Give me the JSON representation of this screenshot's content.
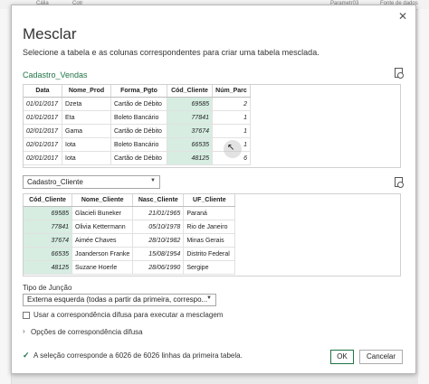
{
  "background": {
    "col_labels": [
      "Cália",
      "Cotr",
      "Parametr03",
      "Fonte de dados"
    ]
  },
  "dialog": {
    "title": "Mesclar",
    "subtitle": "Selecione a tabela e as colunas correspondentes para criar uma tabela mesclada.",
    "close_glyph": "✕"
  },
  "table1": {
    "name": "Cadastro_Vendas",
    "columns": [
      "Data",
      "Nome_Prod",
      "Forma_Pgto",
      "Cód_Cliente",
      "Núm_Parc"
    ],
    "rows": [
      [
        "01/01/2017",
        "Dzeta",
        "Cartão de Débito",
        "69585",
        "2"
      ],
      [
        "01/01/2017",
        "Eta",
        "Boleto Bancário",
        "77841",
        "1"
      ],
      [
        "02/01/2017",
        "Gama",
        "Cartão de Débito",
        "37674",
        "1"
      ],
      [
        "02/01/2017",
        "Iota",
        "Boleto Bancário",
        "66535",
        "1"
      ],
      [
        "02/01/2017",
        "Iota",
        "Cartão de Débito",
        "48125",
        "6"
      ]
    ],
    "selected_column_index": 3
  },
  "table2": {
    "dropdown_value": "Cadastro_Cliente",
    "columns": [
      "Cód_Cliente",
      "Nome_Cliente",
      "Nasc_Cliente",
      "UF_Cliente"
    ],
    "rows": [
      [
        "69585",
        "Glacieli Buneker",
        "21/01/1965",
        "Paraná"
      ],
      [
        "77841",
        "Olivia Kettermann",
        "05/10/1978",
        "Rio de Janeiro"
      ],
      [
        "37674",
        "Aimée Chaves",
        "28/10/1982",
        "Minas Gerais"
      ],
      [
        "66535",
        "Joanderson Franke",
        "15/08/1954",
        "Distrito Federal"
      ],
      [
        "48125",
        "Suzane Hoerle",
        "28/06/1990",
        "Sergipe"
      ]
    ],
    "selected_column_index": 0
  },
  "join": {
    "label": "Tipo de Junção",
    "value": "Externa esquerda (todas a partir da primeira, correspo...",
    "fuzzy_checkbox_label": "Usar a correspondência difusa para executar a mesclagem",
    "fuzzy_checked": false,
    "fuzzy_options_label": "Opções de correspondência difusa"
  },
  "status": {
    "text": "A seleção corresponde a 6026 de 6026 linhas da primeira tabela."
  },
  "buttons": {
    "ok": "OK",
    "cancel": "Cancelar"
  },
  "colors": {
    "accent": "#217346",
    "selected_column": "#d7ede2"
  }
}
